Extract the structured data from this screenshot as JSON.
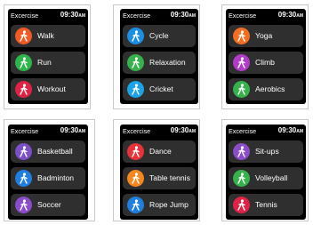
{
  "screens": [
    {
      "title": "Excercise",
      "time": "09:30",
      "ampm": "AM",
      "items": [
        {
          "label": "Walk",
          "color": "#f15a24",
          "icon": "walk-icon"
        },
        {
          "label": "Run",
          "color": "#2eb54a",
          "icon": "run-icon"
        },
        {
          "label": "Workout",
          "color": "#e02244",
          "icon": "workout-icon"
        }
      ]
    },
    {
      "title": "Excercise",
      "time": "09:30",
      "ampm": "AM",
      "items": [
        {
          "label": "Cycle",
          "color": "#1a8fe3",
          "icon": "cycle-icon"
        },
        {
          "label": "Relaxation",
          "color": "#35b34a",
          "icon": "relaxation-icon"
        },
        {
          "label": "Cricket",
          "color": "#1aa3e6",
          "icon": "cricket-icon"
        }
      ]
    },
    {
      "title": "Excercise",
      "time": "09:30",
      "ampm": "AM",
      "items": [
        {
          "label": "Yoga",
          "color": "#f26f21",
          "icon": "yoga-icon"
        },
        {
          "label": "Climb",
          "color": "#b23bc7",
          "icon": "climb-icon"
        },
        {
          "label": "Aerobics",
          "color": "#35b34a",
          "icon": "aerobics-icon"
        }
      ]
    },
    {
      "title": "Excercise",
      "time": "09:30",
      "ampm": "AM",
      "items": [
        {
          "label": "Basketball",
          "color": "#7b4fc6",
          "icon": "basketball-icon"
        },
        {
          "label": "Badminton",
          "color": "#1f7fe0",
          "icon": "badminton-icon"
        },
        {
          "label": "Soccer",
          "color": "#8a4cc8",
          "icon": "soccer-icon"
        }
      ]
    },
    {
      "title": "Excercise",
      "time": "09:30",
      "ampm": "AM",
      "items": [
        {
          "label": "Dance",
          "color": "#e8323a",
          "icon": "dance-icon"
        },
        {
          "label": "Table tennis",
          "color": "#f5871f",
          "icon": "table-tennis-icon"
        },
        {
          "label": "Rope Jump",
          "color": "#1f7fe0",
          "icon": "rope-jump-icon"
        }
      ]
    },
    {
      "title": "Excercise",
      "time": "09:30",
      "ampm": "AM",
      "items": [
        {
          "label": "Sit-ups",
          "color": "#8a4cc8",
          "icon": "sit-ups-icon"
        },
        {
          "label": "Volleyball",
          "color": "#35b34a",
          "icon": "volleyball-icon"
        },
        {
          "label": "Tennis",
          "color": "#e02244",
          "icon": "tennis-icon"
        }
      ]
    }
  ]
}
